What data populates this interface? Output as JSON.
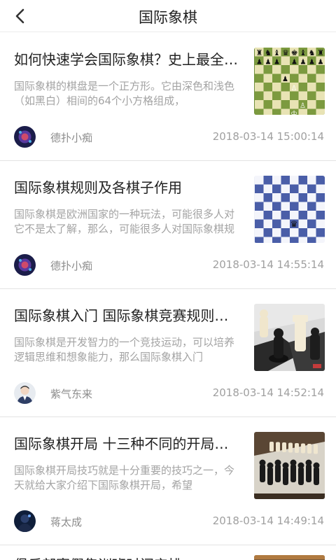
{
  "header": {
    "title": "国际象棋",
    "back_icon": "chevron-left-icon"
  },
  "articles": [
    {
      "title": "如何快速学会国际象棋？史上最全的国际象棋入门",
      "desc": "国际象棋的棋盘是一个正方形。它由深色和浅色（如黑白）相间的64个小方格组成，",
      "author": "德扑小痴",
      "date": "2018-03-14 15:00:14"
    },
    {
      "title": "国际象棋规则及各棋子作用",
      "desc": "国际象棋是欧洲国家的一种玩法，可能很多人对它不是太了解，那么，可能很多人对国际象棋规则",
      "author": "德扑小痴",
      "date": "2018-03-14 14:55:14"
    },
    {
      "title": "国际象棋入门 国际象棋竞赛规则详解",
      "desc": "国际象棋是开发智力的一个竞技运动，可以培养逻辑思维和想象能力，那么国际象棋入门",
      "author": "紫气东来",
      "date": "2018-03-14 14:52:14"
    },
    {
      "title": "国际象棋开局 十三种不同的开局方法",
      "desc": "国际象棋开局技巧就是十分重要的技巧之一，今天就给大家介绍下国际象棋开局，希望",
      "author": "蒋太成",
      "date": "2018-03-14 14:49:14"
    },
    {
      "title": "俱乐部寒假集训班时间安排"
    }
  ]
}
